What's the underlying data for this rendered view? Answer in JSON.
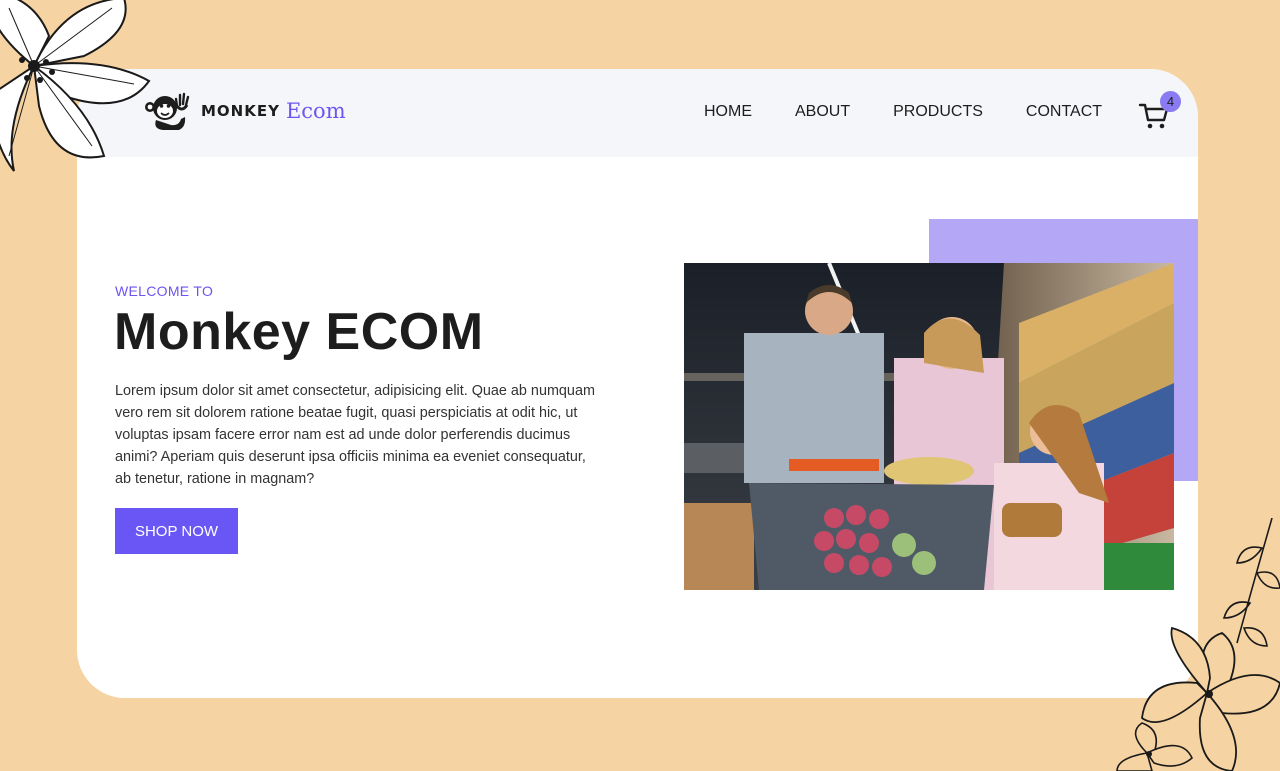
{
  "brand": {
    "name_part1": "MONKEY",
    "name_part2": "Ecom"
  },
  "nav": {
    "links": [
      {
        "label": "HOME"
      },
      {
        "label": "ABOUT"
      },
      {
        "label": "PRODUCTS"
      },
      {
        "label": "CONTACT"
      }
    ],
    "cart_count": "4"
  },
  "hero": {
    "eyebrow": "WELCOME TO",
    "title": "Monkey ECOM",
    "description": "Lorem ipsum dolor sit amet consectetur, adipisicing elit. Quae ab numquam vero rem sit dolorem ratione beatae fugit, quasi perspiciatis at odit hic, ut voluptas ipsam facere error nam est ad unde dolor perferendis ducimus animi? Aperiam quis deserunt ipsa officiis minima ea eveniet consequatur, ab tenetur, ratione in magnam?",
    "cta_label": "SHOP NOW"
  },
  "colors": {
    "background": "#f6d3a2",
    "accent": "#6a56f5",
    "accent_light": "#b4a8f6",
    "navbar": "#f4f6f9",
    "text": "#1d1d1d"
  },
  "icons": {
    "logo": "monkey-logo-icon",
    "cart": "shopping-cart-icon",
    "decor_top_left": "flower-icon",
    "decor_bottom_right": "floral-branch-icon"
  }
}
